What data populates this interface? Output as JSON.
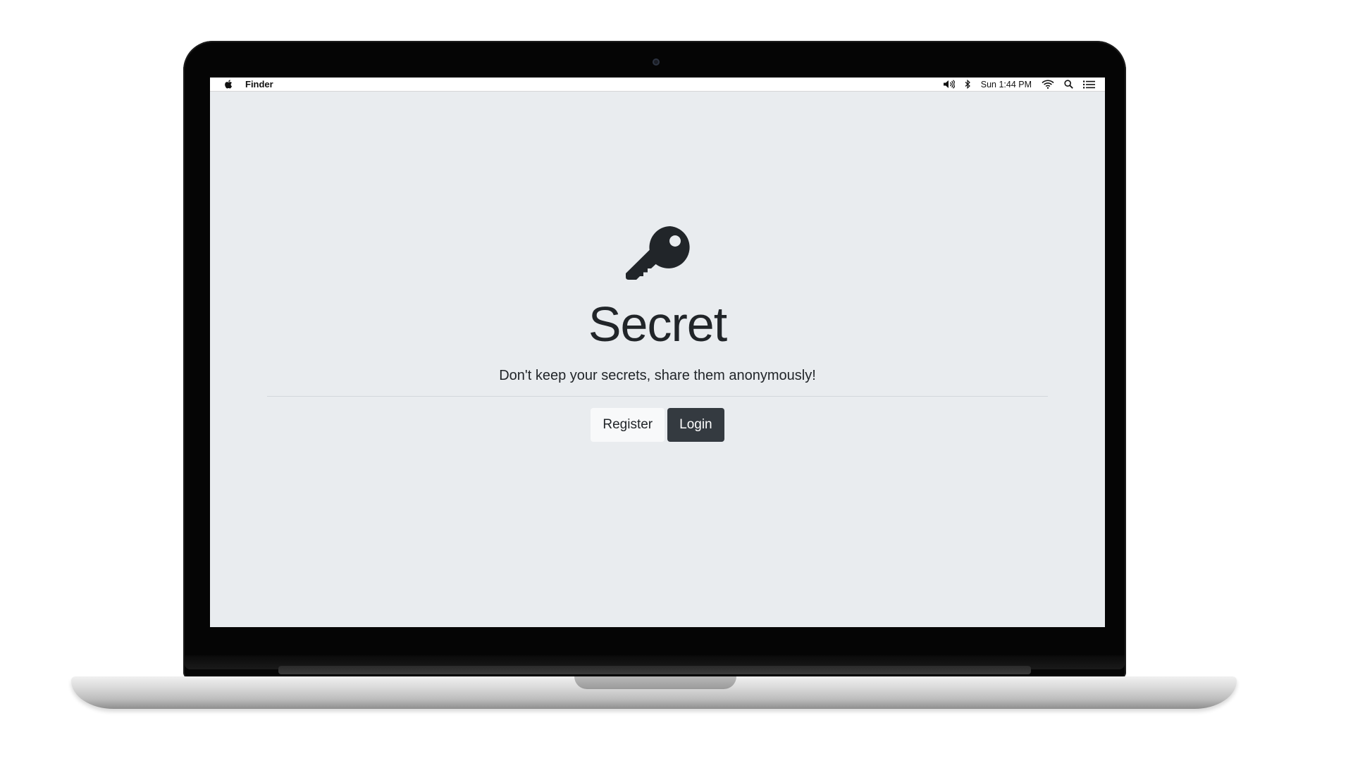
{
  "menubar": {
    "app_name": "Finder",
    "clock": "Sun 1:44 PM",
    "icons": [
      "apple-icon",
      "volume-icon",
      "bluetooth-icon",
      "wifi-icon",
      "search-icon",
      "list-icon"
    ]
  },
  "hero": {
    "icon": "key-icon",
    "title": "Secret",
    "lead": "Don't keep your secrets, share them anonymously!",
    "register_label": "Register",
    "login_label": "Login"
  },
  "colors": {
    "page_background": "#e9ecef",
    "text": "#212529",
    "button_light": "#f8f9fa",
    "button_dark": "#343a40"
  }
}
